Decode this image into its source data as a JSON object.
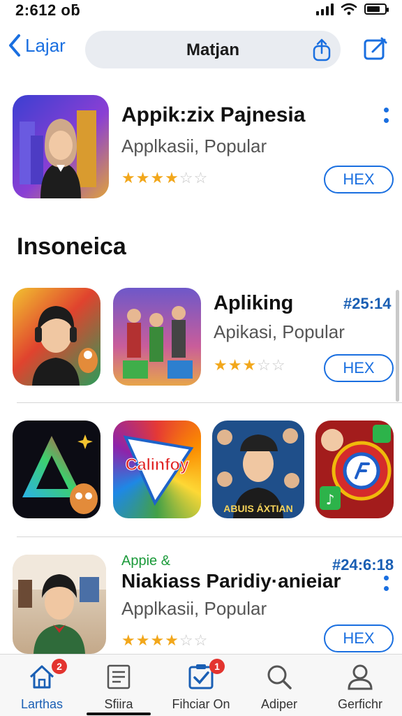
{
  "status_bar": {
    "time": "2:612 ᴏƃ"
  },
  "nav": {
    "back_label": "Lajar",
    "search_label": "Matjan"
  },
  "featured": {
    "title": "Appik:zix Pajnesia",
    "subtitle": "Applkasii, Popular",
    "rating": 4,
    "button": "HEX"
  },
  "section_title": "Insoneica",
  "app_row_2": {
    "title": "Apliking",
    "price": "#25:14",
    "subtitle": "Apikasi, Popular",
    "rating": 3,
    "button": "HEX"
  },
  "tiles": [
    {
      "name": "calinfoy-tile",
      "label": "Calinfoy"
    },
    {
      "name": "abuls-tile",
      "label": "ABUIS ÁXTIAN"
    }
  ],
  "app_row_3": {
    "tag": "Appie &",
    "price": "#24:6:18",
    "title": "Niakiass Paridiy·anieiar",
    "subtitle": "Applkasii, Popular",
    "rating": 4,
    "button": "HEX"
  },
  "tabbar": {
    "tabs": [
      {
        "label": "Larthas",
        "icon": "home-icon",
        "badge": "2"
      },
      {
        "label": "Sfiira",
        "icon": "document-icon",
        "badge": ""
      },
      {
        "label": "Fihciar On",
        "icon": "clipboard-check-icon",
        "badge": "1"
      },
      {
        "label": "Adiper",
        "icon": "search-icon",
        "badge": ""
      },
      {
        "label": "Gerfichr",
        "icon": "person-icon",
        "badge": ""
      }
    ]
  },
  "colors": {
    "accent": "#1a6fe0",
    "star": "#f2a71b",
    "badge": "#e3342f",
    "tag_green": "#1b9a3a"
  }
}
